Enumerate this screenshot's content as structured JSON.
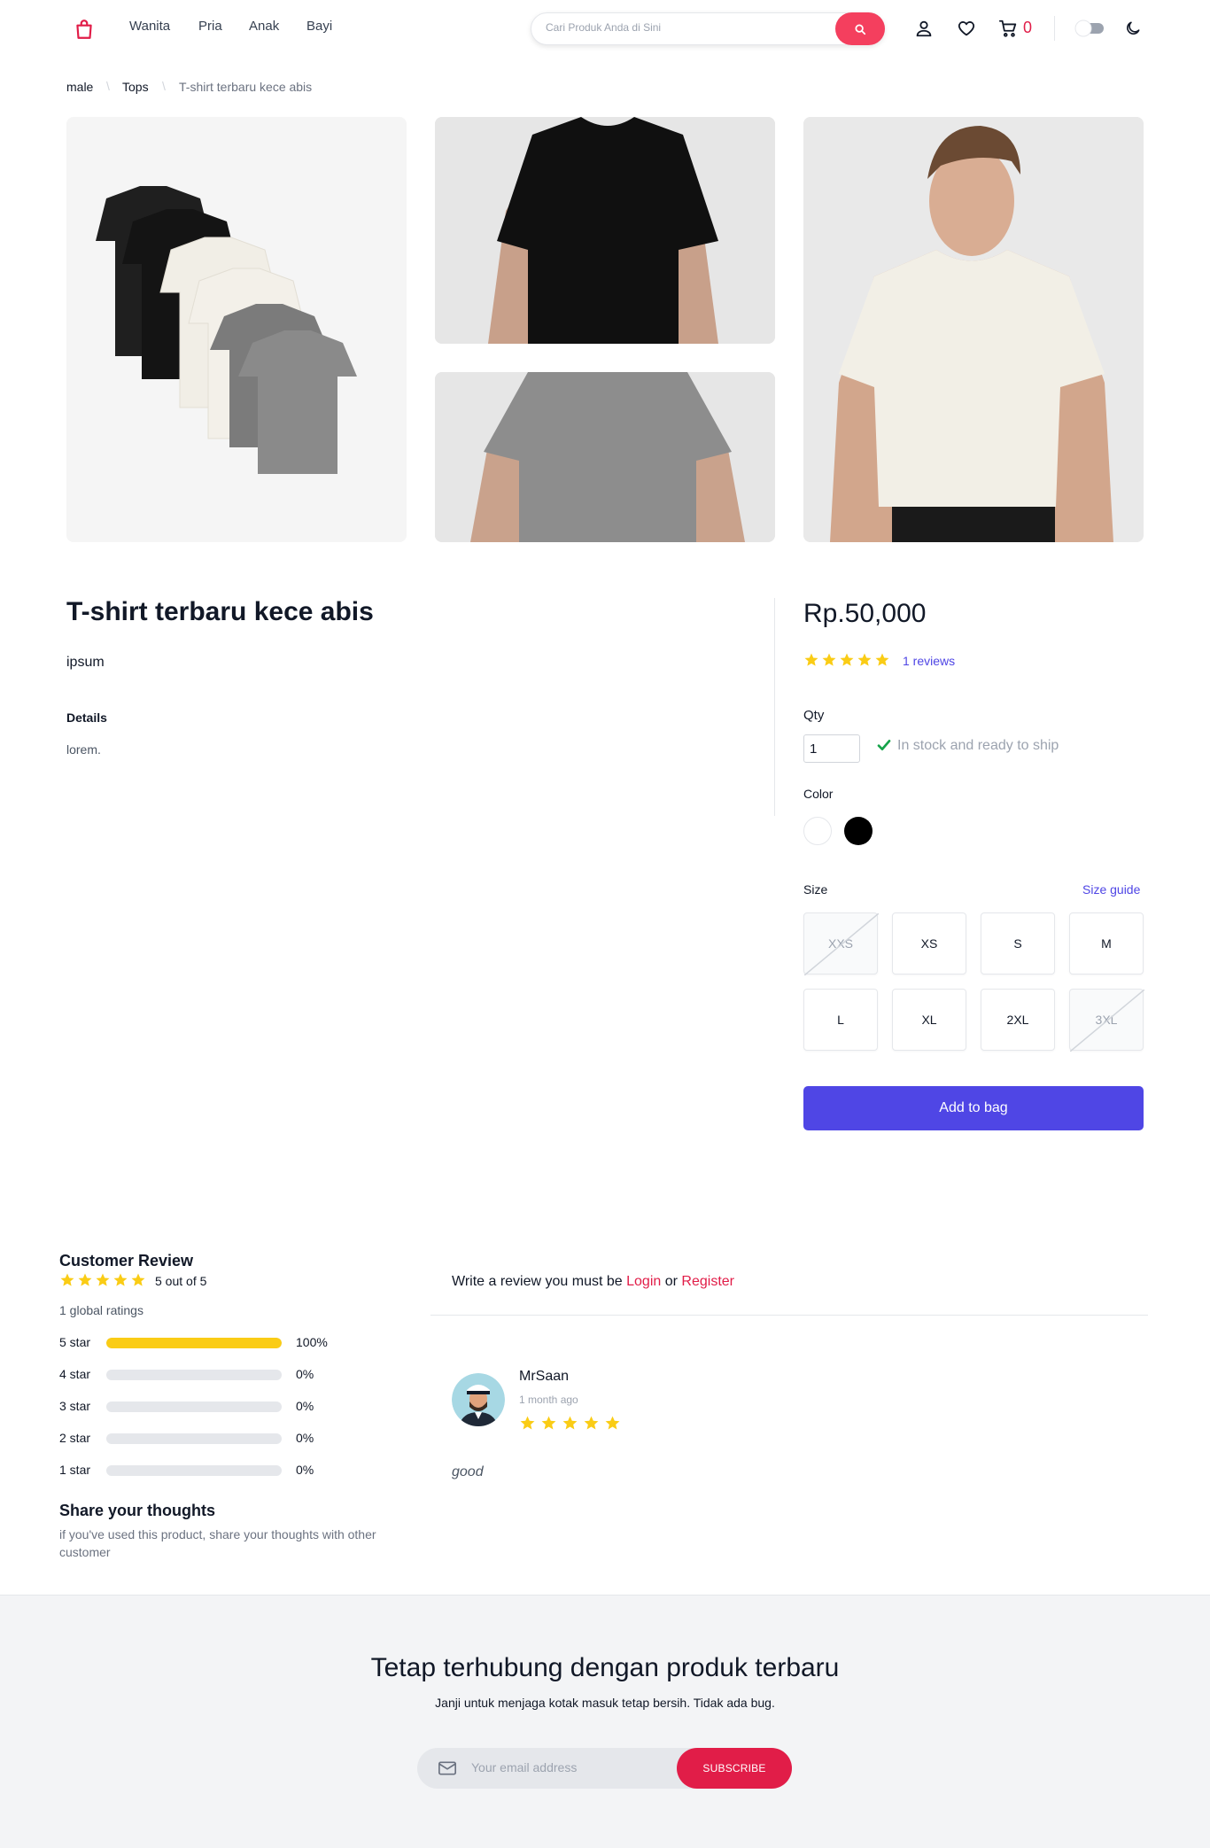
{
  "header": {
    "nav": [
      "Wanita",
      "Pria",
      "Anak",
      "Bayi"
    ],
    "search_placeholder": "Cari Produk Anda di Sini",
    "cart_count": "0",
    "accent_color": "#f43f5e"
  },
  "breadcrumb": [
    "male",
    "Tops",
    "T-shirt terbaru kece abis"
  ],
  "product": {
    "title": "T-shirt terbaru kece abis",
    "subtitle": "ipsum",
    "details_heading": "Details",
    "details_text": "lorem.",
    "price": "Rp.50,000",
    "rating": 5,
    "reviews_link": "1 reviews",
    "qty_label": "Qty",
    "qty_value": "1",
    "stock_text": "In stock and ready to ship",
    "color_label": "Color",
    "colors": [
      "#ffffff",
      "#000000"
    ],
    "size_label": "Size",
    "size_guide": "Size guide",
    "sizes": [
      {
        "label": "XXS",
        "available": false
      },
      {
        "label": "XS",
        "available": true
      },
      {
        "label": "S",
        "available": true
      },
      {
        "label": "M",
        "available": true
      },
      {
        "label": "L",
        "available": true
      },
      {
        "label": "XL",
        "available": true
      },
      {
        "label": "2XL",
        "available": true
      },
      {
        "label": "3XL",
        "available": false
      }
    ],
    "add_to_bag": "Add to bag"
  },
  "customer_review": {
    "title": "Customer Review",
    "rating_text": "5 out of 5",
    "global_ratings": "1 global ratings",
    "bars": [
      {
        "label": "5 star",
        "percent": 100,
        "text": "100%"
      },
      {
        "label": "4 star",
        "percent": 0,
        "text": "0%"
      },
      {
        "label": "3 star",
        "percent": 0,
        "text": "0%"
      },
      {
        "label": "2 star",
        "percent": 0,
        "text": "0%"
      },
      {
        "label": "1 star",
        "percent": 0,
        "text": "0%"
      }
    ],
    "share_heading": "Share your thoughts",
    "share_text": "if you've used this product, share your thoughts with other customer"
  },
  "write_review": {
    "prefix": "Write a review you must be",
    "login": "Login",
    "or": "or",
    "register": "Register"
  },
  "review": {
    "name": "MrSaan",
    "time": "1 month ago",
    "stars": 5,
    "text": "good"
  },
  "newsletter": {
    "title": "Tetap terhubung dengan produk terbaru",
    "subtitle": "Janji untuk menjaga kotak masuk tetap bersih. Tidak ada bug.",
    "email_placeholder": "Your email address",
    "subscribe": "SUBSCRIBE"
  }
}
